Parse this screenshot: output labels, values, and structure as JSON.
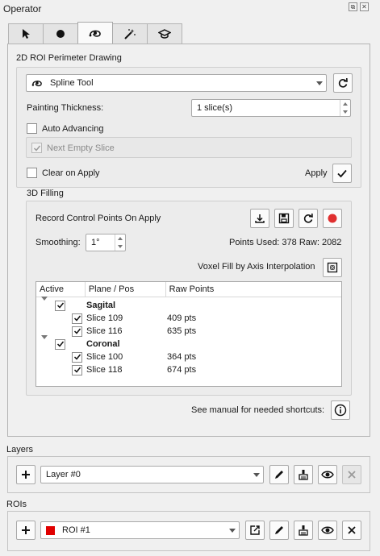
{
  "panel": {
    "title": "Operator",
    "float_icon": "⧉",
    "close_icon": "✕"
  },
  "tabs": [
    {
      "icon": "pointer-arrow-icon",
      "active": false
    },
    {
      "icon": "filled-circle-icon",
      "active": false
    },
    {
      "icon": "spline-tool-icon",
      "active": true
    },
    {
      "icon": "magic-wand-icon",
      "active": false
    },
    {
      "icon": "graduation-cap-icon",
      "active": false
    }
  ],
  "roi_drawing": {
    "title": "2D ROI Perimeter Drawing",
    "tool": "Spline Tool",
    "painting_thickness_label": "Painting Thickness:",
    "painting_thickness_value": "1 slice(s)",
    "auto_advancing_label": "Auto Advancing",
    "auto_advancing_checked": false,
    "next_empty_slice_label": "Next Empty Slice",
    "next_empty_slice_checked": true,
    "clear_on_apply_label": "Clear on Apply",
    "clear_on_apply_checked": false,
    "apply_label": "Apply"
  },
  "filling": {
    "title": "3D Filling",
    "record_label": "Record Control Points On Apply",
    "smoothing_label": "Smoothing:",
    "smoothing_value": "1°",
    "points_used": "Points Used: 378 Raw: 2082",
    "voxel_fill_label": "Voxel Fill by Axis Interpolation",
    "record_color": "#e03030",
    "table": {
      "headers": [
        "Active",
        "Plane / Pos",
        "Raw Points"
      ],
      "groups": [
        {
          "name": "Sagital",
          "rows": [
            {
              "slice": "Slice 109",
              "pts": "409 pts"
            },
            {
              "slice": "Slice 116",
              "pts": "635 pts"
            }
          ]
        },
        {
          "name": "Coronal",
          "rows": [
            {
              "slice": "Slice 100",
              "pts": "364 pts"
            },
            {
              "slice": "Slice 118",
              "pts": "674 pts"
            }
          ]
        }
      ]
    },
    "manual_label": "See manual for needed shortcuts:"
  },
  "layers": {
    "title": "Layers",
    "selected": "Layer #0"
  },
  "rois": {
    "title": "ROIs",
    "selected": "ROI #1",
    "color": "#e00000"
  }
}
